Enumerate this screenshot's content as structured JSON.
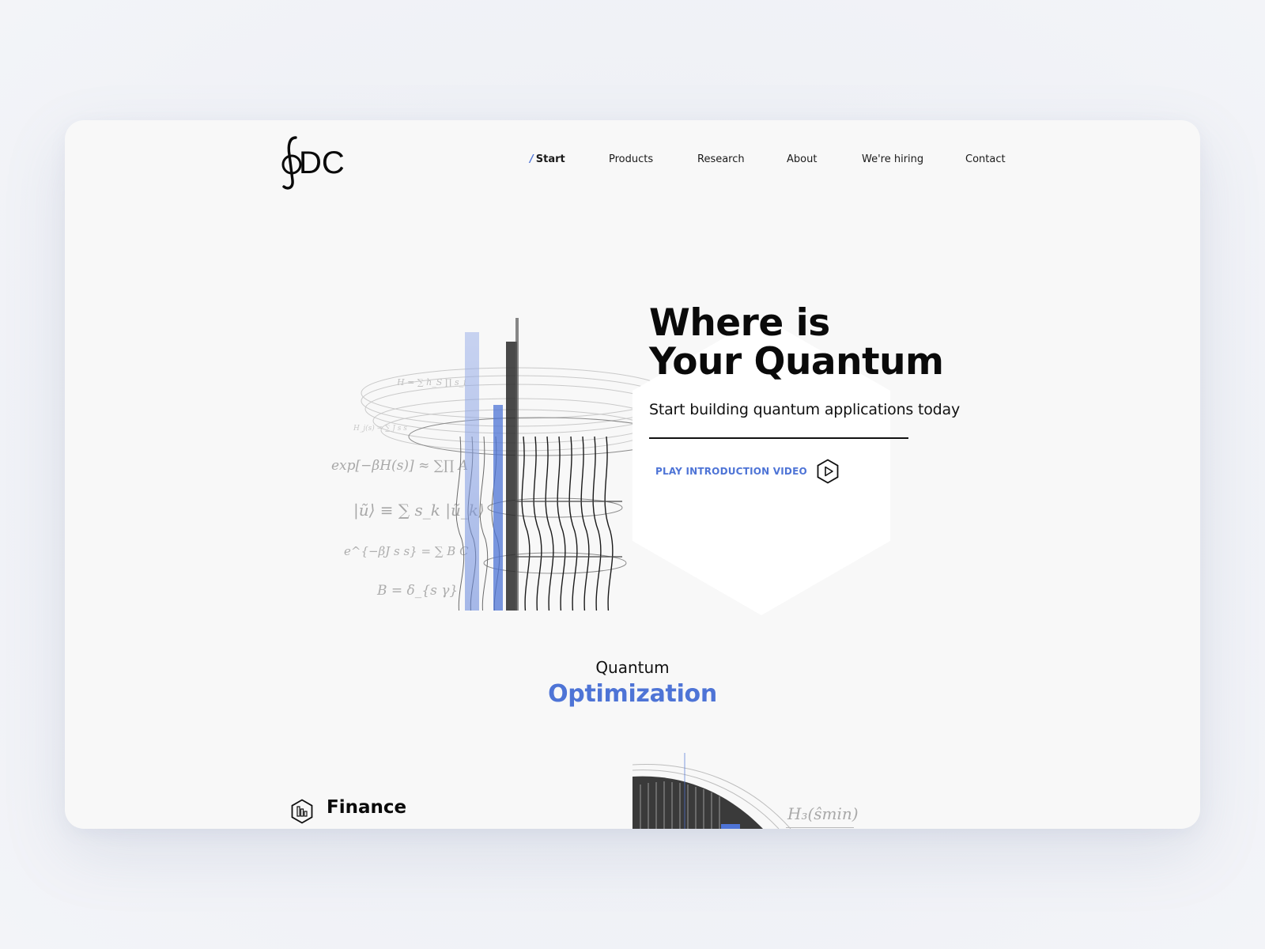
{
  "brand": {
    "logo_text": "DC",
    "logo_symbol": "∮"
  },
  "nav": {
    "items": [
      {
        "label": "Start",
        "active": true
      },
      {
        "label": "Products",
        "active": false
      },
      {
        "label": "Research",
        "active": false
      },
      {
        "label": "About",
        "active": false
      },
      {
        "label": "We're hiring",
        "active": false
      },
      {
        "label": "Contact",
        "active": false
      }
    ],
    "active_marker": "/"
  },
  "hero": {
    "title_line1": "Where is",
    "title_line2": "Your Quantum",
    "subtitle": "Start building quantum applications today",
    "cta_label": "PLAY INTRODUCTION VIDEO",
    "cta_icon": "play-hexagon-icon"
  },
  "section": {
    "kicker": "Quantum",
    "title": "Optimization"
  },
  "finance": {
    "label": "Finance",
    "icon": "bar-chart-hexagon-icon"
  },
  "bottom_formula": "H₃(ŝmin)",
  "colors": {
    "accent": "#4e74d6",
    "text": "#0a0a0a",
    "card_bg": "#f8f8f8",
    "page_bg": "#eef0f5",
    "hexagon": "#ffffff"
  }
}
